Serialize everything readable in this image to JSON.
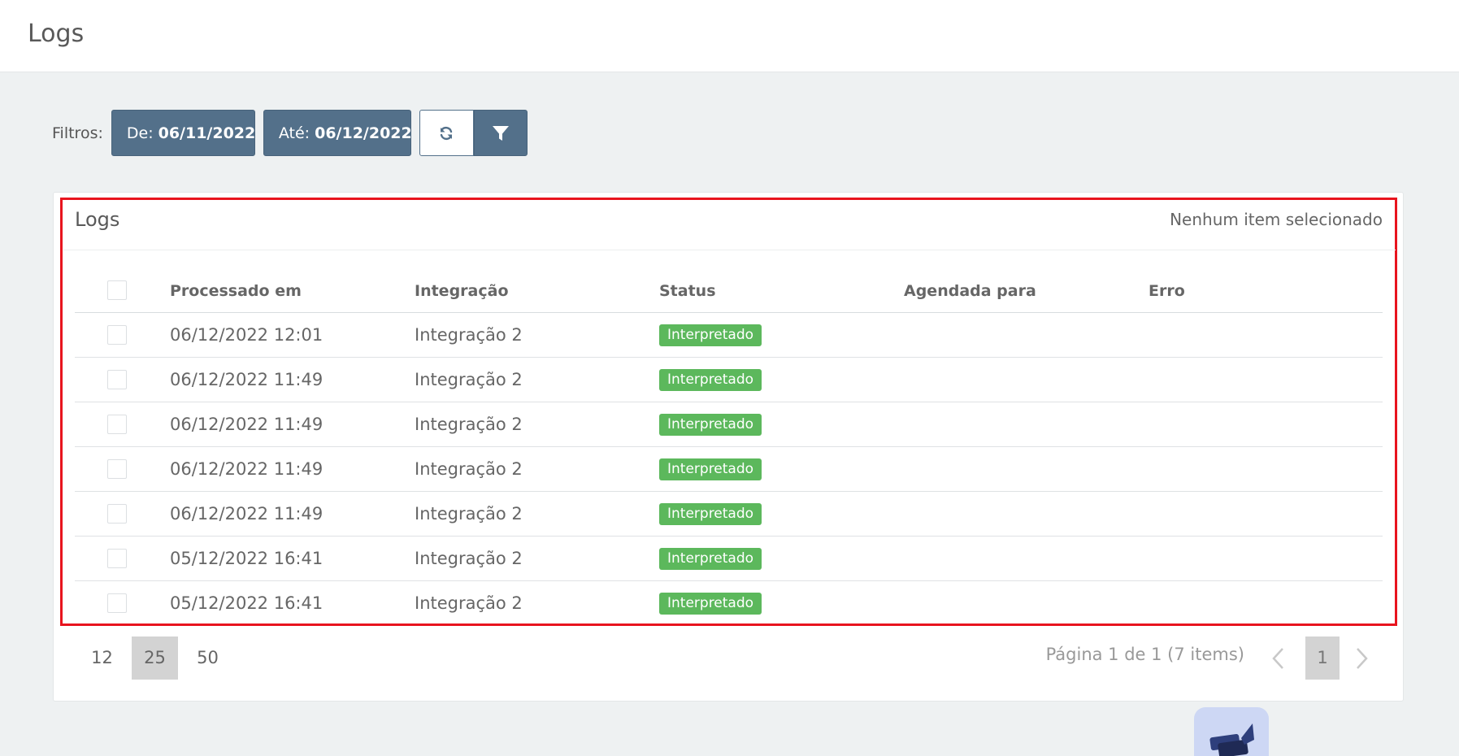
{
  "header": {
    "title": "Logs"
  },
  "filters": {
    "label": "Filtros:",
    "from_prefix": "De:",
    "from_value": "06/11/2022",
    "to_prefix": "Até:",
    "to_value": "06/12/2022",
    "refresh_icon": "refresh-icon",
    "filter_icon": "filter-icon"
  },
  "card": {
    "title": "Logs",
    "selection_status": "Nenhum item selecionado"
  },
  "table": {
    "columns": [
      "Processado em",
      "Integração",
      "Status",
      "Agendada para",
      "Erro"
    ],
    "rows": [
      {
        "processed": "06/12/2022 12:01",
        "integration": "Integração 2",
        "status": "Interpretado",
        "scheduled": "",
        "error": ""
      },
      {
        "processed": "06/12/2022 11:49",
        "integration": "Integração 2",
        "status": "Interpretado",
        "scheduled": "",
        "error": ""
      },
      {
        "processed": "06/12/2022 11:49",
        "integration": "Integração 2",
        "status": "Interpretado",
        "scheduled": "",
        "error": ""
      },
      {
        "processed": "06/12/2022 11:49",
        "integration": "Integração 2",
        "status": "Interpretado",
        "scheduled": "",
        "error": ""
      },
      {
        "processed": "06/12/2022 11:49",
        "integration": "Integração 2",
        "status": "Interpretado",
        "scheduled": "",
        "error": ""
      },
      {
        "processed": "05/12/2022 16:41",
        "integration": "Integração 2",
        "status": "Interpretado",
        "scheduled": "",
        "error": ""
      },
      {
        "processed": "05/12/2022 16:41",
        "integration": "Integração 2",
        "status": "Interpretado",
        "scheduled": "",
        "error": ""
      }
    ]
  },
  "pagination": {
    "page_sizes": [
      "12",
      "25",
      "50"
    ],
    "active_page_size": "25",
    "info": "Página 1 de 1 (7 items)",
    "current_page": "1"
  },
  "colors": {
    "primary": "#53708a",
    "success": "#5cb85c",
    "highlight": "#e8141e",
    "background": "#eef1f2"
  }
}
